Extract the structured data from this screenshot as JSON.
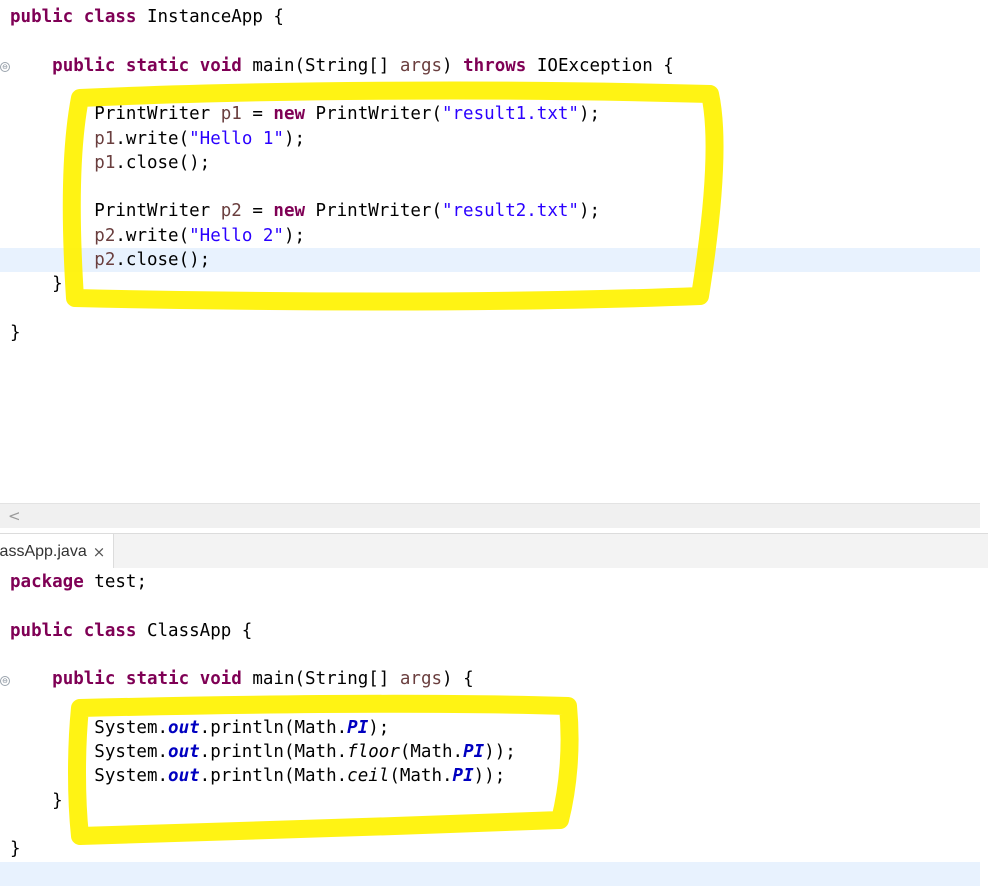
{
  "editor_top": {
    "lines": [
      [
        [
          "kw",
          "public"
        ],
        [
          "t",
          " "
        ],
        [
          "kw",
          "class"
        ],
        [
          "t",
          " InstanceApp {"
        ]
      ],
      [],
      [
        [
          "t",
          "    "
        ],
        [
          "kw",
          "public"
        ],
        [
          "t",
          " "
        ],
        [
          "kw",
          "static"
        ],
        [
          "t",
          " "
        ],
        [
          "kw",
          "void"
        ],
        [
          "t",
          " main(String[] "
        ],
        [
          "var",
          "args"
        ],
        [
          "t",
          ") "
        ],
        [
          "kw",
          "throws"
        ],
        [
          "t",
          " IOException {"
        ]
      ],
      [],
      [
        [
          "t",
          "        PrintWriter "
        ],
        [
          "var",
          "p1"
        ],
        [
          "t",
          " = "
        ],
        [
          "kw",
          "new"
        ],
        [
          "t",
          " PrintWriter("
        ],
        [
          "str",
          "\"result1.txt\""
        ],
        [
          "t",
          ");"
        ]
      ],
      [
        [
          "t",
          "        "
        ],
        [
          "var",
          "p1"
        ],
        [
          "t",
          ".write("
        ],
        [
          "str",
          "\"Hello 1\""
        ],
        [
          "t",
          ");"
        ]
      ],
      [
        [
          "t",
          "        "
        ],
        [
          "var",
          "p1"
        ],
        [
          "t",
          ".close();"
        ]
      ],
      [],
      [
        [
          "t",
          "        PrintWriter "
        ],
        [
          "var",
          "p2"
        ],
        [
          "t",
          " = "
        ],
        [
          "kw",
          "new"
        ],
        [
          "t",
          " PrintWriter("
        ],
        [
          "str",
          "\"result2.txt\""
        ],
        [
          "t",
          ");"
        ]
      ],
      [
        [
          "t",
          "        "
        ],
        [
          "var",
          "p2"
        ],
        [
          "t",
          ".write("
        ],
        [
          "str",
          "\"Hello 2\""
        ],
        [
          "t",
          ");"
        ]
      ],
      [
        [
          "t",
          "        "
        ],
        [
          "var",
          "p2"
        ],
        [
          "t",
          ".close();"
        ]
      ],
      [
        [
          "t",
          "    }"
        ]
      ],
      [],
      [
        [
          "t",
          "}"
        ]
      ]
    ]
  },
  "scrollbar": {
    "left_arrow": "<"
  },
  "tab": {
    "label": "lassApp.java",
    "close": "×"
  },
  "editor_bottom": {
    "lines": [
      [
        [
          "kw",
          "package"
        ],
        [
          "t",
          " test;"
        ]
      ],
      [],
      [
        [
          "kw",
          "public"
        ],
        [
          "t",
          " "
        ],
        [
          "kw",
          "class"
        ],
        [
          "t",
          " ClassApp {"
        ]
      ],
      [],
      [
        [
          "t",
          "    "
        ],
        [
          "kw",
          "public"
        ],
        [
          "t",
          " "
        ],
        [
          "kw",
          "static"
        ],
        [
          "t",
          " "
        ],
        [
          "kw",
          "void"
        ],
        [
          "t",
          " main(String[] "
        ],
        [
          "var",
          "args"
        ],
        [
          "t",
          ") {"
        ]
      ],
      [],
      [
        [
          "t",
          "        System."
        ],
        [
          "fld",
          "out"
        ],
        [
          "t",
          ".println(Math."
        ],
        [
          "fld",
          "PI"
        ],
        [
          "t",
          ");"
        ]
      ],
      [
        [
          "t",
          "        System."
        ],
        [
          "fld",
          "out"
        ],
        [
          "t",
          ".println(Math."
        ],
        [
          "ital",
          "floor"
        ],
        [
          "t",
          "(Math."
        ],
        [
          "fld",
          "PI"
        ],
        [
          "t",
          "));"
        ]
      ],
      [
        [
          "t",
          "        System."
        ],
        [
          "fld",
          "out"
        ],
        [
          "t",
          ".println(Math."
        ],
        [
          "ital",
          "ceil"
        ],
        [
          "t",
          "(Math."
        ],
        [
          "fld",
          "PI"
        ],
        [
          "t",
          "));"
        ]
      ],
      [
        [
          "t",
          "    }"
        ]
      ],
      [],
      [
        [
          "t",
          "}"
        ]
      ],
      []
    ]
  },
  "colors": {
    "keyword": "#7f0055",
    "string": "#2a00ff",
    "local_variable": "#6a3e3e",
    "static_field": "#0000c0",
    "current_line": "#e8f2fe",
    "highlighter": "#fff200"
  }
}
